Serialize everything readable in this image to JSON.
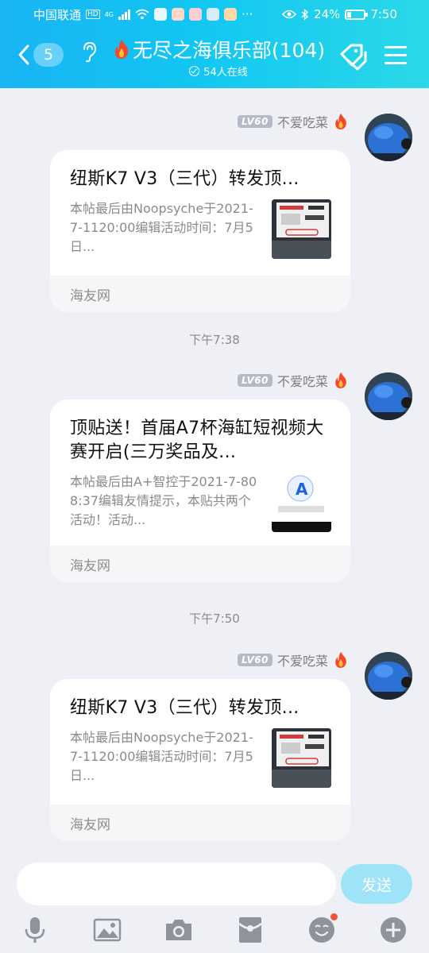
{
  "status_bar": {
    "carrier": "中国联通",
    "network": "4G",
    "battery": "24%",
    "time": "7:50",
    "more": "···"
  },
  "header": {
    "back_count": "5",
    "title": "无尽之海俱乐部(104)",
    "online": "54人在线"
  },
  "messages": [
    {
      "sender": "不爱吃菜",
      "level": "LV60",
      "card_title": "纽斯K7 V3（三代）转发顶...",
      "card_desc": "本帖最后由Noopsyche于2021-7-1120:00编辑活动时间：7月5日...",
      "card_source": "海友网"
    },
    {
      "time": "下午7:38",
      "sender": "不爱吃菜",
      "level": "LV60",
      "card_title": "顶贴送！首届A7杯海缸短视频大赛开启(三万奖品及...",
      "card_desc": "本帖最后由A+智控于2021-7-808:37编辑友情提示，本贴共两个活动！活动...",
      "card_source": "海友网"
    },
    {
      "time": "下午7:50",
      "sender": "不爱吃菜",
      "level": "LV60",
      "card_title": "纽斯K7 V3（三代）转发顶...",
      "card_desc": "本帖最后由Noopsyche于2021-7-1120:00编辑活动时间：7月5日...",
      "card_source": "海友网"
    }
  ],
  "input": {
    "placeholder": "",
    "send_label": "发送"
  },
  "colors": {
    "header_start": "#18b4f4",
    "header_end": "#2ad9e8",
    "send_button": "#9fe3f8",
    "notification_dot": "#f2543a"
  },
  "icons": {
    "toolbar": [
      "microphone-icon",
      "image-icon",
      "camera-icon",
      "red-packet-icon",
      "emoji-icon",
      "plus-icon"
    ]
  }
}
